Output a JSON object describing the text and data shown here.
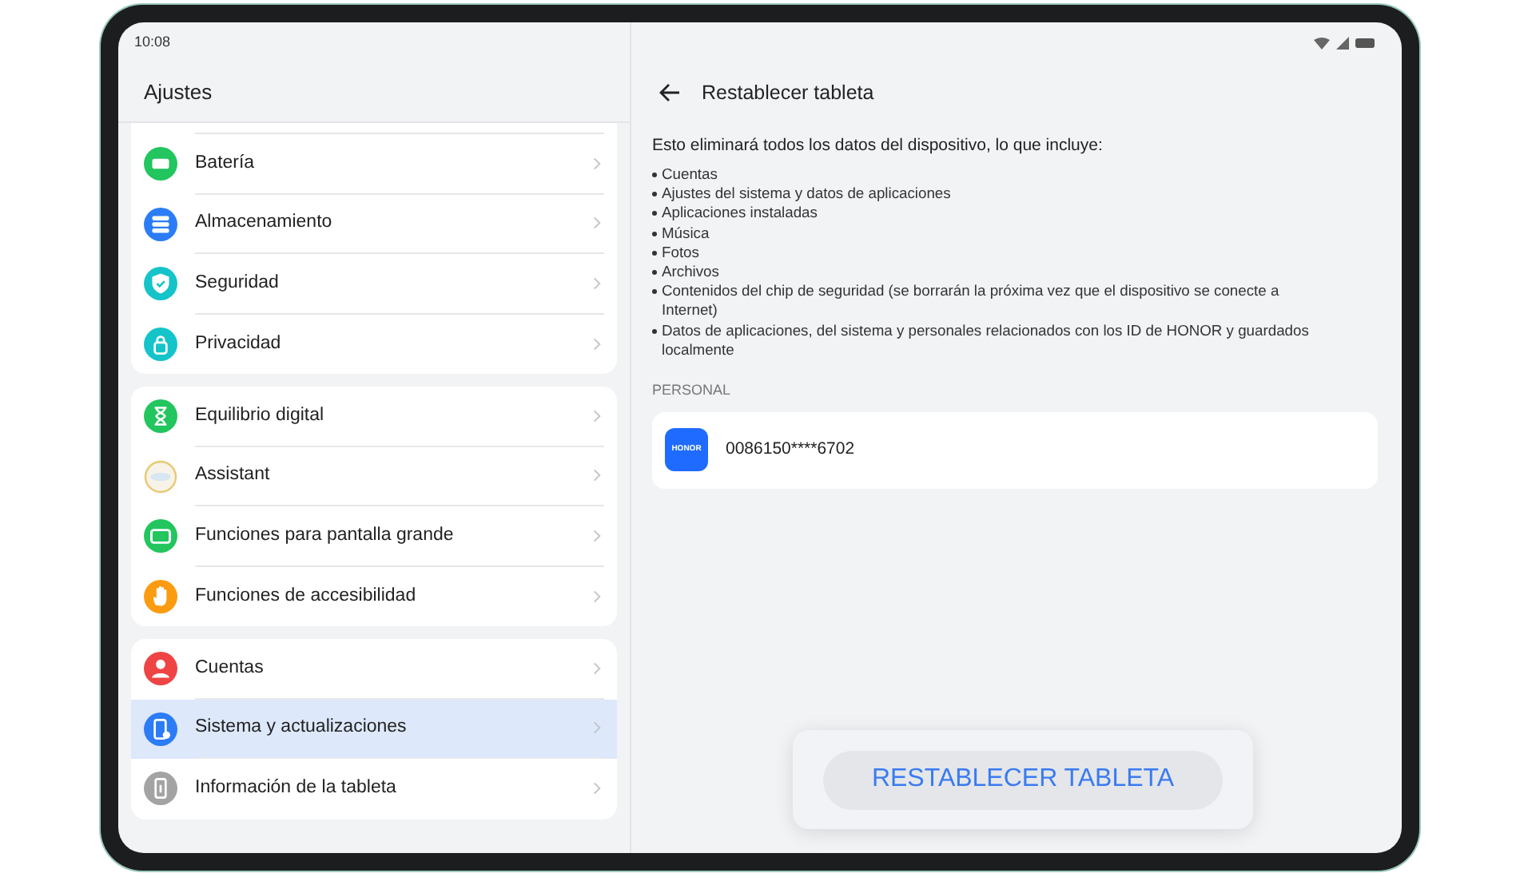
{
  "status_bar": {
    "time": "10:08"
  },
  "sidebar": {
    "title": "Ajustes",
    "groups": [
      {
        "items": [
          {
            "label": "Batería",
            "kind": "battery",
            "selected": false
          },
          {
            "label": "Almacenamiento",
            "kind": "storage",
            "selected": false
          },
          {
            "label": "Seguridad",
            "kind": "shield",
            "selected": false
          },
          {
            "label": "Privacidad",
            "kind": "lock",
            "selected": false
          }
        ]
      },
      {
        "items": [
          {
            "label": "Equilibrio digital",
            "kind": "hourglass",
            "selected": false
          },
          {
            "label": "Assistant",
            "kind": "assistant",
            "selected": false
          },
          {
            "label": "Funciones para pantalla grande",
            "kind": "screen",
            "selected": false
          },
          {
            "label": "Funciones de accesibilidad",
            "kind": "hand",
            "selected": false
          }
        ]
      },
      {
        "items": [
          {
            "label": "Cuentas",
            "kind": "person",
            "selected": false
          },
          {
            "label": "Sistema y actualizaciones",
            "kind": "system",
            "selected": true
          },
          {
            "label": "Información de la tableta",
            "kind": "info",
            "selected": false
          }
        ]
      }
    ]
  },
  "detail": {
    "title": "Restablecer tableta",
    "intro": "Esto eliminará todos los datos del dispositivo, lo que incluye:",
    "bullets": [
      "Cuentas",
      "Ajustes del sistema y datos de aplicaciones",
      "Aplicaciones instaladas",
      "Música",
      "Fotos",
      "Archivos",
      "Contenidos del chip de seguridad (se borrarán la próxima vez que el dispositivo se conecte a Internet)",
      "Datos de aplicaciones, del sistema y personales relacionados con los ID de HONOR y guardados localmente"
    ],
    "section": "PERSONAL",
    "account": {
      "logo": "HONOR",
      "number": "0086150****6702"
    },
    "button": "RESTABLECER TABLETA"
  }
}
